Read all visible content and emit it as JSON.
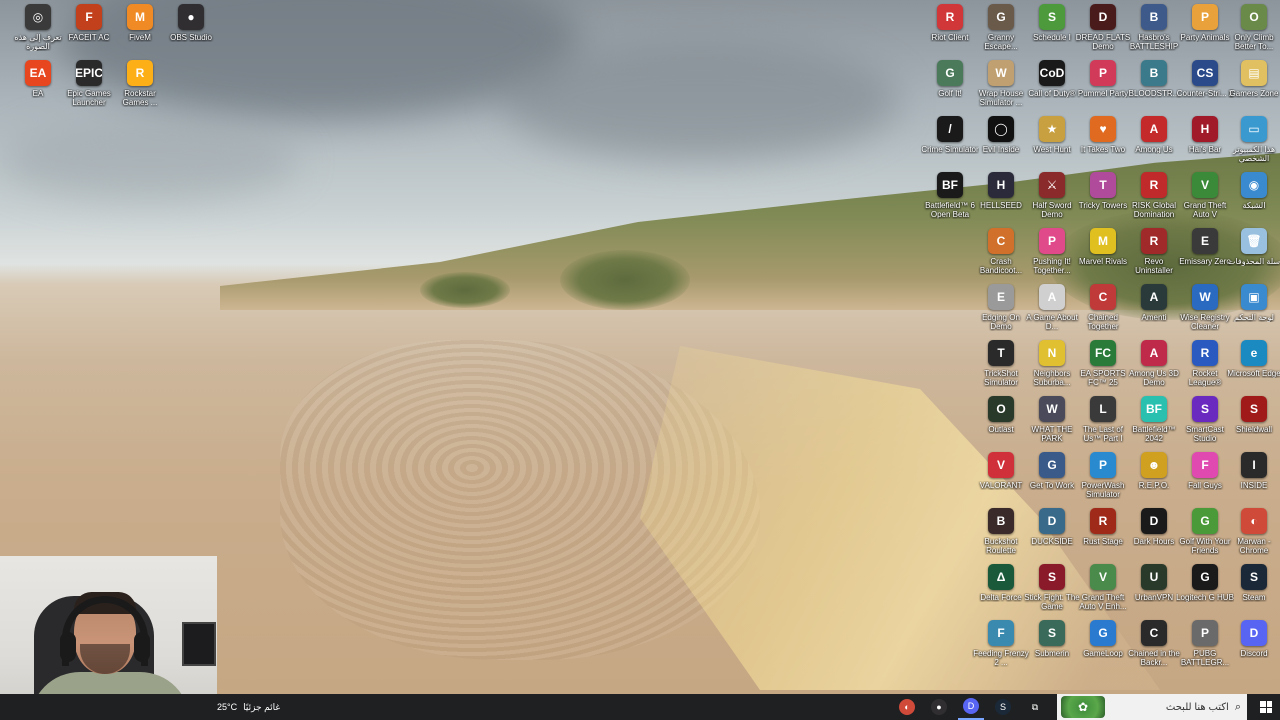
{
  "wallpaper": {
    "description_name": "beach-dunes"
  },
  "desktop_icons_left": [
    {
      "label": "تعرف إلى هذه الصورة",
      "color": "#3a3a3a",
      "glyph": "◎",
      "rtl": true
    },
    {
      "label": "FACEIT AC",
      "color": "#c2411c",
      "glyph": "F"
    },
    {
      "label": "FiveM",
      "color": "#f08a24",
      "glyph": "M"
    },
    {
      "label": "OBS Studio",
      "color": "#302e31",
      "glyph": "●"
    },
    {
      "label": "EA",
      "color": "#e8461f",
      "glyph": "EA"
    },
    {
      "label": "Epic Games Launcher",
      "color": "#2a2a2a",
      "glyph": "EPIC"
    },
    {
      "label": "Rockstar Games ...",
      "color": "#fcaf17",
      "glyph": "R"
    }
  ],
  "desktop_icons_right": [
    [
      {
        "label": "Riot Client",
        "color": "#d13639",
        "glyph": "R"
      },
      {
        "label": "Granny Escape...",
        "color": "#6a5a4a",
        "glyph": "G"
      },
      {
        "label": "Schedule I",
        "color": "#4c9a3c",
        "glyph": "S"
      },
      {
        "label": "DREAD FLATS Demo",
        "color": "#4a1b1b",
        "glyph": "D"
      },
      {
        "label": "Hasbro's BATTLESHIP",
        "color": "#3d5a8a",
        "glyph": "B"
      },
      {
        "label": "Party Animals",
        "color": "#e9a23b",
        "glyph": "P"
      },
      {
        "label": "Only Climb Better To...",
        "color": "#6a8a4a",
        "glyph": "O"
      }
    ],
    [
      {
        "label": "Golf It!",
        "color": "#4a7a5a",
        "glyph": "G"
      },
      {
        "label": "Wrap House Simulator ...",
        "color": "#c0a070",
        "glyph": "W"
      },
      {
        "label": "Call of Duty®",
        "color": "#1a1a1a",
        "glyph": "CoD"
      },
      {
        "label": "Pummel Party",
        "color": "#d23a5a",
        "glyph": "P"
      },
      {
        "label": "BLOODSTR...",
        "color": "#3a7a8a",
        "glyph": "B"
      },
      {
        "label": "Counter-Stri... 2",
        "color": "#2a4a8a",
        "glyph": "CS"
      },
      {
        "label": "Gamers Zone",
        "color": "#e0c060",
        "glyph": "▤"
      }
    ],
    [
      {
        "label": "Crime Simulator",
        "color": "#1a1a1a",
        "glyph": "/"
      },
      {
        "label": "Evil Inside",
        "color": "#111111",
        "glyph": "◯"
      },
      {
        "label": "West Hunt",
        "color": "#c8a040",
        "glyph": "★"
      },
      {
        "label": "It Takes Two",
        "color": "#e06a20",
        "glyph": "♥"
      },
      {
        "label": "Among Us",
        "color": "#c42a2a",
        "glyph": "A"
      },
      {
        "label": "Hai's Bar",
        "color": "#a01a2a",
        "glyph": "H"
      },
      {
        "label": "هذا الكمبيوتر الشخصي",
        "color": "#3a9ad0",
        "glyph": "▭",
        "rtl": true
      }
    ],
    [
      {
        "label": "Battlefield™ 6 Open Beta",
        "color": "#1a1a1a",
        "glyph": "BF"
      },
      {
        "label": "HELLSEED",
        "color": "#2a2a3a",
        "glyph": "H"
      },
      {
        "label": "Half Sword Demo",
        "color": "#8a2a2a",
        "glyph": "⚔"
      },
      {
        "label": "Tricky Towers",
        "color": "#b04a9a",
        "glyph": "T"
      },
      {
        "label": "RISK Global Domination",
        "color": "#c02a2a",
        "glyph": "R"
      },
      {
        "label": "Grand Theft Auto V",
        "color": "#3a8a3a",
        "glyph": "V"
      },
      {
        "label": "الشبكة",
        "color": "#3a8ad0",
        "glyph": "◉",
        "rtl": true
      }
    ],
    [
      {
        "label": "Crash Bandicoot...",
        "color": "#d0702a",
        "glyph": "C"
      },
      {
        "label": "Pushing It! Together...",
        "color": "#e04a8a",
        "glyph": "P"
      },
      {
        "label": "Marvel Rivals",
        "color": "#e0c020",
        "glyph": "M"
      },
      {
        "label": "Revo Uninstaller",
        "color": "#a02a2a",
        "glyph": "R"
      },
      {
        "label": "Emissary Zero",
        "color": "#3a3a3a",
        "glyph": "E"
      },
      {
        "label": "سلة المحذوفات",
        "color": "#9ac0e0",
        "glyph": "🗑",
        "rtl": true
      }
    ],
    [
      {
        "label": "Edging On Demo",
        "color": "#9a9a9a",
        "glyph": "E"
      },
      {
        "label": "A Game About D...",
        "color": "#d0d0d0",
        "glyph": "A"
      },
      {
        "label": "Chained Together",
        "color": "#c03a3a",
        "glyph": "C"
      },
      {
        "label": "Amenti",
        "color": "#2a3a3a",
        "glyph": "A"
      },
      {
        "label": "Wise Registry Cleaner",
        "color": "#2a6ac0",
        "glyph": "W"
      },
      {
        "label": "لوحة التحكم",
        "color": "#3a8ad0",
        "glyph": "▣",
        "rtl": true
      }
    ],
    [
      {
        "label": "TrickShot Simulator",
        "color": "#2a2a2a",
        "glyph": "T"
      },
      {
        "label": "Neighbors Suburba...",
        "color": "#e0c030",
        "glyph": "N"
      },
      {
        "label": "EA SPORTS FC™ 25",
        "color": "#2a7a3a",
        "glyph": "FC"
      },
      {
        "label": "Among Us 3D Demo",
        "color": "#c02a4a",
        "glyph": "A"
      },
      {
        "label": "Rocket League®",
        "color": "#2a5ac0",
        "glyph": "R"
      },
      {
        "label": "Microsoft Edge",
        "color": "#1a8ac0",
        "glyph": "e"
      }
    ],
    [
      {
        "label": "Outlast",
        "color": "#2a3a2a",
        "glyph": "O"
      },
      {
        "label": "WHAT THE PARK",
        "color": "#4a4a5a",
        "glyph": "W"
      },
      {
        "label": "The Last of Us™ Part I",
        "color": "#3a3a3a",
        "glyph": "L"
      },
      {
        "label": "Battlefield™ 2042",
        "color": "#2ac0b0",
        "glyph": "BF"
      },
      {
        "label": "SmartCast Studio",
        "color": "#6a2ac0",
        "glyph": "S"
      },
      {
        "label": "Shieldwall",
        "color": "#a01a1a",
        "glyph": "S"
      }
    ],
    [
      {
        "label": "VALORANT",
        "color": "#d0303a",
        "glyph": "V"
      },
      {
        "label": "Get To Work",
        "color": "#3a5a8a",
        "glyph": "G"
      },
      {
        "label": "PowerWash Simulator",
        "color": "#2a8ad0",
        "glyph": "P"
      },
      {
        "label": "R.E.P.O.",
        "color": "#d0a020",
        "glyph": "☻"
      },
      {
        "label": "Fall Guys",
        "color": "#e04ab0",
        "glyph": "F"
      },
      {
        "label": "INSIDE",
        "color": "#2a2a2a",
        "glyph": "I"
      }
    ],
    [
      {
        "label": "Buckshot Roulette",
        "color": "#3a2a2a",
        "glyph": "B"
      },
      {
        "label": "DUCKSIDE",
        "color": "#3a6a8a",
        "glyph": "D"
      },
      {
        "label": "Rust Stage",
        "color": "#a02a1a",
        "glyph": "R"
      },
      {
        "label": "Dark Hours",
        "color": "#1a1a1a",
        "glyph": "D"
      },
      {
        "label": "Golf With Your Friends",
        "color": "#4a9a3a",
        "glyph": "G"
      },
      {
        "label": "Marwan - Chrome",
        "color": "#d04a3a",
        "glyph": "◐"
      }
    ],
    [
      {
        "label": "Delta Force",
        "color": "#1a5a3a",
        "glyph": "Δ"
      },
      {
        "label": "Stick Fight: The Game",
        "color": "#8a1a2a",
        "glyph": "S"
      },
      {
        "label": "Grand Theft Auto V Enh...",
        "color": "#4a8a4a",
        "glyph": "V"
      },
      {
        "label": "UrbanVPN",
        "color": "#2a3a2a",
        "glyph": "U"
      },
      {
        "label": "Logitech G HUB",
        "color": "#1a1a1a",
        "glyph": "G"
      },
      {
        "label": "Steam",
        "color": "#1b2838",
        "glyph": "S"
      }
    ],
    [
      {
        "label": "Feeding Frenzy 2 ...",
        "color": "#3a8ab0",
        "glyph": "F"
      },
      {
        "label": "Submerin",
        "color": "#3a6a5a",
        "glyph": "S"
      },
      {
        "label": "GameLoop",
        "color": "#2a7ad0",
        "glyph": "G"
      },
      {
        "label": "Chained in the Backr...",
        "color": "#2a2a2a",
        "glyph": "C"
      },
      {
        "label": "PUBG BATTLEGR...",
        "color": "#6a6a6a",
        "glyph": "P"
      },
      {
        "label": "Discord",
        "color": "#5865f2",
        "glyph": "D"
      }
    ]
  ],
  "taskbar": {
    "weather_temp": "25°C",
    "weather_text": "غائم جزئيًا",
    "search_placeholder": "اكتب هنا للبحث",
    "apps": [
      {
        "name": "chrome-taskbar-icon",
        "color": "#d04a3a",
        "glyph": "◐"
      },
      {
        "name": "obs-taskbar-icon",
        "color": "#302e31",
        "glyph": "●"
      },
      {
        "name": "discord-taskbar-icon",
        "color": "#5865f2",
        "glyph": "D",
        "active": true
      },
      {
        "name": "steam-taskbar-icon",
        "color": "#1b2838",
        "glyph": "S"
      },
      {
        "name": "task-view-taskbar-icon",
        "color": "#1f2022",
        "glyph": "⧉"
      }
    ]
  }
}
